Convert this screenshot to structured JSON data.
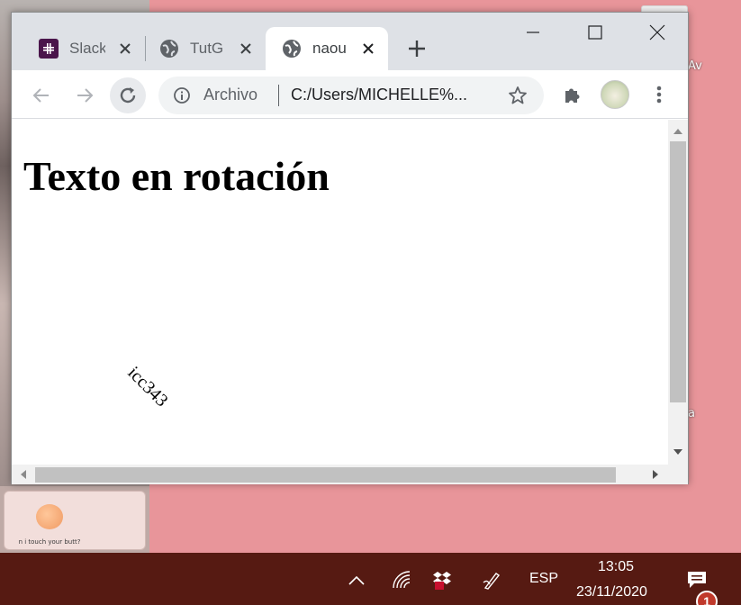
{
  "browser": {
    "tabs": [
      {
        "title": "Slack",
        "favicon": "slack-icon",
        "active": false
      },
      {
        "title": "TutG",
        "favicon": "globe-icon",
        "active": false
      },
      {
        "title": "naou",
        "favicon": "globe-icon",
        "active": true
      }
    ],
    "omnibox": {
      "scheme_label": "Archivo",
      "url": "C:/Users/MICHELLE%..."
    },
    "icons": {
      "back": "arrow-left-icon",
      "forward": "arrow-right-icon",
      "reload": "reload-icon",
      "info": "info-icon",
      "bookmark": "star-icon",
      "extensions": "puzzle-icon",
      "menu": "kebab-menu-icon",
      "new_tab": "plus-icon"
    }
  },
  "page": {
    "heading": "Texto en rotación",
    "rotated_text": "icc343"
  },
  "desktop": {
    "icon_labels": [
      "Av",
      "a"
    ],
    "sticker_text": "n i touch your butt?"
  },
  "taskbar": {
    "language": "ESP",
    "time": "13:05",
    "date": "23/11/2020",
    "notification_count": "1"
  },
  "colors": {
    "desktop_pink": "#e8959a",
    "taskbar": "#561a12",
    "tabstrip": "#dee1e6",
    "slack_purple": "#4a154b"
  }
}
